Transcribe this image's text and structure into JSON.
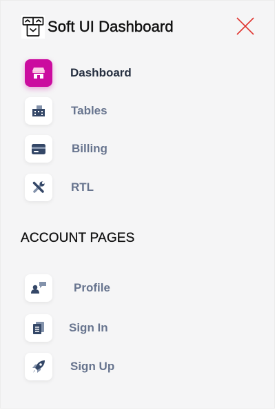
{
  "brand": {
    "name": "Soft UI Dashboard"
  },
  "nav": [
    {
      "label": "Dashboard",
      "icon": "shop-icon",
      "active": true
    },
    {
      "label": "Tables",
      "icon": "office-icon",
      "active": false
    },
    {
      "label": "Billing",
      "icon": "credit-card-icon",
      "active": false
    },
    {
      "label": "RTL",
      "icon": "tools-icon",
      "active": false
    }
  ],
  "section": {
    "title": "ACCOUNT PAGES"
  },
  "account": [
    {
      "label": "Profile",
      "icon": "user-chat-icon"
    },
    {
      "label": "Sign In",
      "icon": "document-icon"
    },
    {
      "label": "Sign Up",
      "icon": "rocket-icon"
    }
  ],
  "colors": {
    "accent": "#cb0c9f",
    "icon": "#344767",
    "label": "#67748e",
    "active_label": "#252f40",
    "close": "#e0342f"
  }
}
